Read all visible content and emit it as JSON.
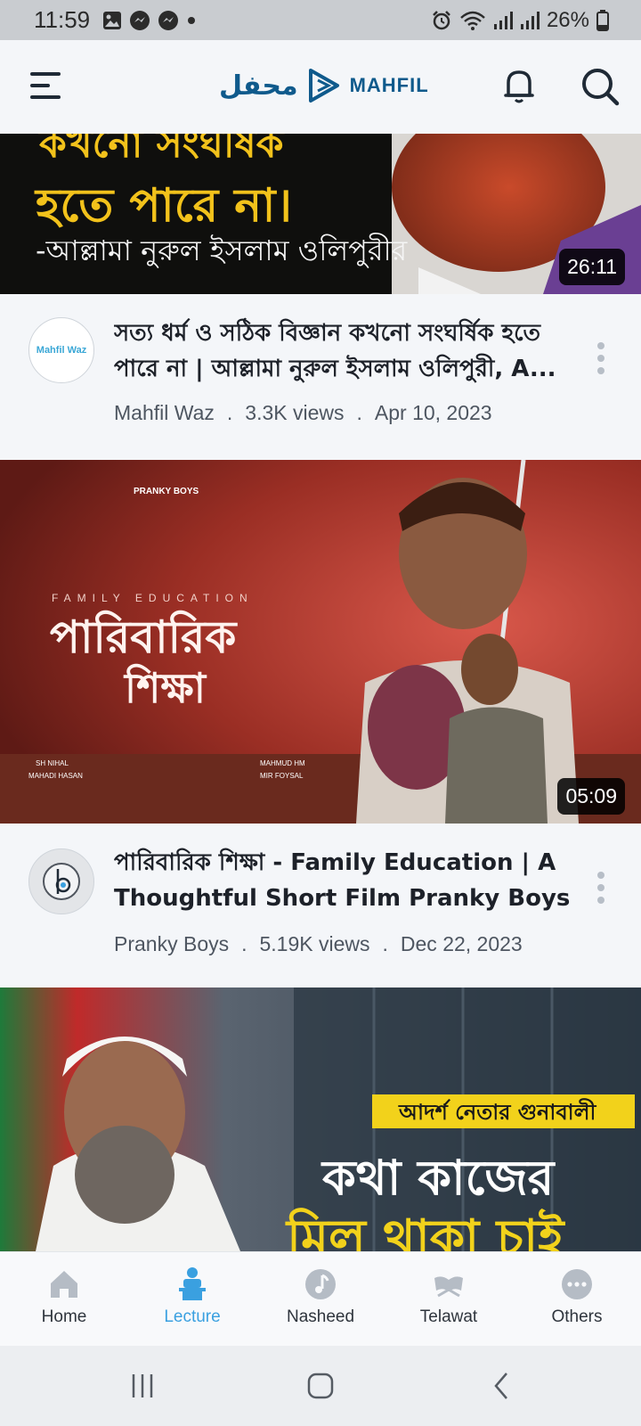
{
  "status_bar": {
    "time": "11:59",
    "battery": "26%",
    "left_icons": [
      "image-icon",
      "messenger-icon",
      "messenger-icon",
      "dot-icon"
    ],
    "right_icons": [
      "alarm-icon",
      "wifi-icon",
      "signal-icon",
      "signal-icon",
      "battery-icon"
    ]
  },
  "header": {
    "logo_arabic": "محفل",
    "logo_text": "MAHFIL",
    "brand_color": "#0f5a8c"
  },
  "videos": [
    {
      "thumb_text_line1": "কখনো সংঘর্ষিক",
      "thumb_text_line2": "হতে পারে না।",
      "thumb_text_line3": "-আল্লামা নুরুল ইসলাম ওলিপুরীর",
      "duration": "26:11",
      "avatar_text": "Mahfil Waz",
      "title": "সত্য ধর্ম ও সঠিক বিজ্ঞান কখনো সংঘর্ষিক হতে পারে না | আল্লামা নুরুল ইসলাম ওলিপুরী, A...",
      "channel": "Mahfil Waz",
      "views": "3.3K views",
      "date": "Apr 10, 2023"
    },
    {
      "thumb_top": "PRANKY BOYS",
      "thumb_subtitle": "FAMILY EDUCATION",
      "thumb_title_line1": "পারিবারিক",
      "thumb_title_line2": "শিক্ষা",
      "credit_left1": "SH NIHAL",
      "credit_left2": "MAHADI HASAN",
      "credit_right1": "MAHMUD HM",
      "credit_right2": "MIR FOYSAL",
      "duration": "05:09",
      "title": "পারিবারিক শিক্ষা - Family Education | A Thoughtful Short Film Pranky Boys",
      "channel": "Pranky Boys",
      "views": "5.19K views",
      "date": "Dec 22, 2023"
    },
    {
      "thumb_banner": "আদর্শ নেতার গুনাবালী",
      "thumb_line1": "কথা কাজের",
      "thumb_line2": "মিল থাকা চাই"
    }
  ],
  "meta_separator": ".",
  "bottom_nav": [
    {
      "label": "Home",
      "icon": "home-icon",
      "active": false
    },
    {
      "label": "Lecture",
      "icon": "lecture-icon",
      "active": true
    },
    {
      "label": "Nasheed",
      "icon": "music-note-icon",
      "active": false
    },
    {
      "label": "Telawat",
      "icon": "quran-icon",
      "active": false
    },
    {
      "label": "Others",
      "icon": "more-dots-icon",
      "active": false
    }
  ],
  "colors": {
    "active_tab": "#3aa0e0",
    "background": "#f4f6f9"
  }
}
